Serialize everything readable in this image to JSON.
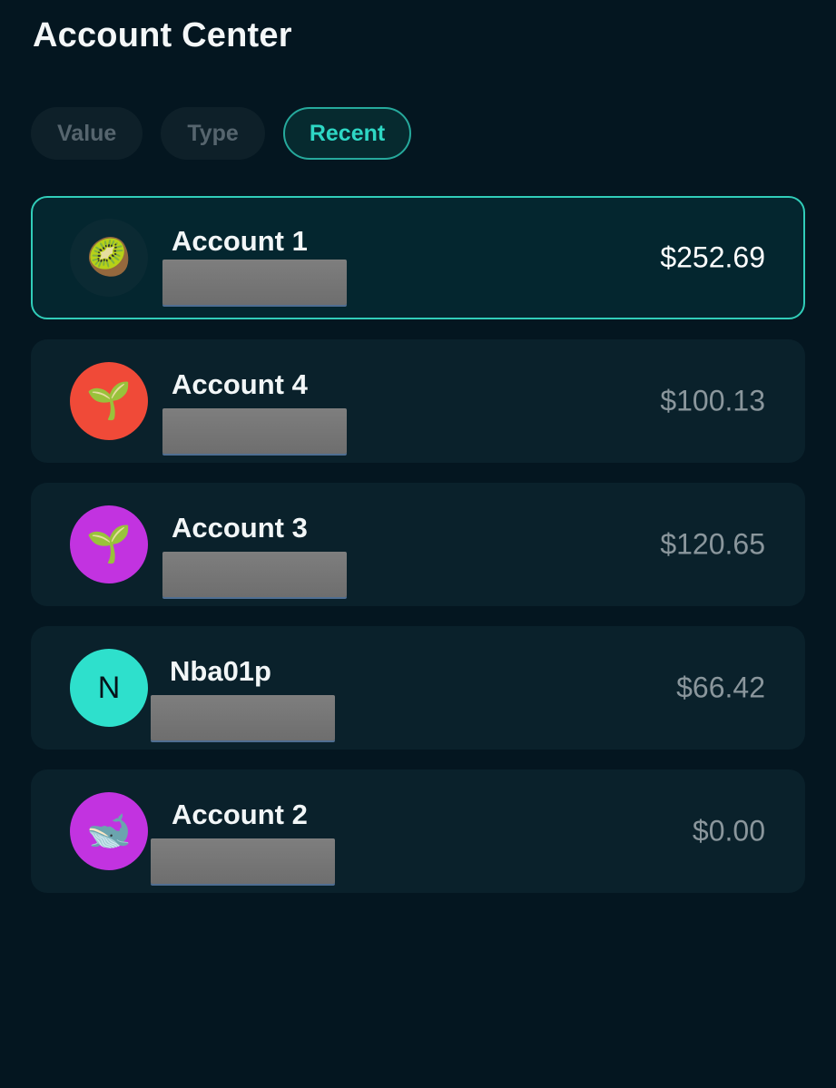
{
  "header": {
    "title": "Account Center"
  },
  "filters": [
    {
      "label": "Value",
      "active": false
    },
    {
      "label": "Type",
      "active": false
    },
    {
      "label": "Recent",
      "active": true
    }
  ],
  "accounts": [
    {
      "name": "Account 1",
      "value": "$252.69",
      "icon": "kiwi-icon",
      "glyph": "🥝",
      "avatar_color": "#0b2a33",
      "selected": true
    },
    {
      "name": "Account 4",
      "value": "$100.13",
      "icon": "seedling-icon",
      "glyph": "🌱",
      "avatar_color": "#f04a38",
      "selected": false
    },
    {
      "name": "Account 3",
      "value": "$120.65",
      "icon": "seedling-icon",
      "glyph": "🌱",
      "avatar_color": "#c233e0",
      "selected": false
    },
    {
      "name": "Nba01p",
      "value": "$66.42",
      "icon": "letter-avatar",
      "glyph": "N",
      "avatar_color": "#2ee0cc",
      "selected": false
    },
    {
      "name": "Account 2",
      "value": "$0.00",
      "icon": "whale-icon",
      "glyph": "🐋",
      "avatar_color": "#c233e0",
      "selected": false
    }
  ]
}
